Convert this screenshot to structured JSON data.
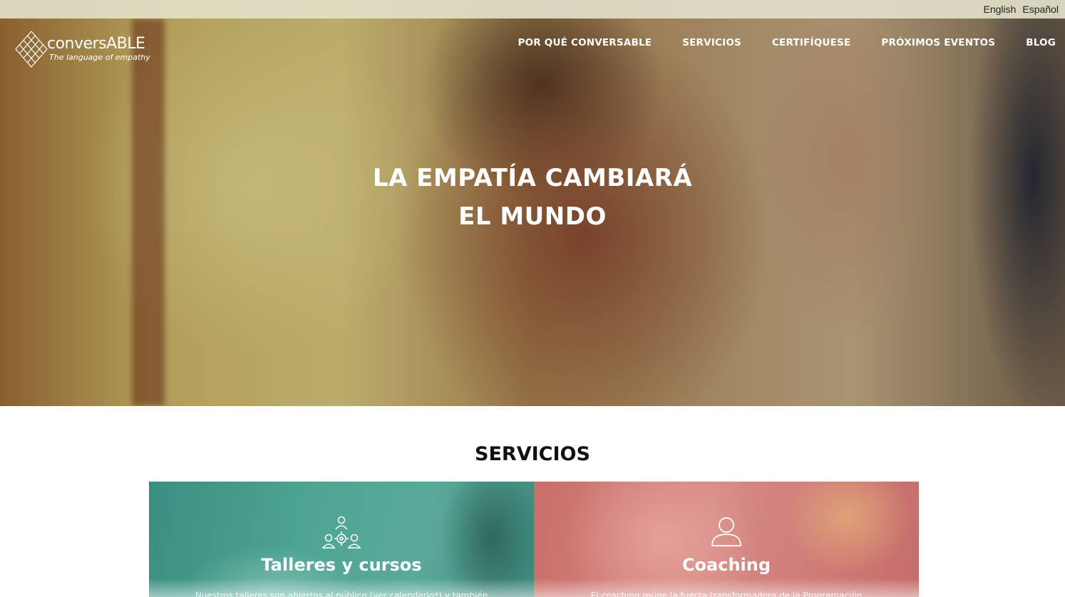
{
  "languages": {
    "english": "English",
    "spanish": "Español"
  },
  "header": {
    "logo_brand": "conversABLE",
    "logo_tagline": "The language of empathy",
    "nav": [
      {
        "label": "POR QUÉ CONVERSABLE"
      },
      {
        "label": "SERVICIOS"
      },
      {
        "label": "CERTIFÍQUESE"
      },
      {
        "label": "PRÓXIMOS EVENTOS"
      },
      {
        "label": "BLOG"
      }
    ]
  },
  "hero": {
    "title_line1": "LA EMPATÍA CAMBIARÁ",
    "title_line2": "EL MUNDO"
  },
  "services": {
    "heading": "SERVICIOS",
    "cards": [
      {
        "title": "Talleres y cursos",
        "description": "Nuestros talleres son abiertos al público (ver calendario*) y también",
        "icon": "group-icon",
        "color": "#4ea493"
      },
      {
        "title": "Coaching",
        "description": "El coaching reúne la fuerza transformadora de la Programación",
        "icon": "person-icon",
        "color": "#d58a85"
      }
    ]
  }
}
